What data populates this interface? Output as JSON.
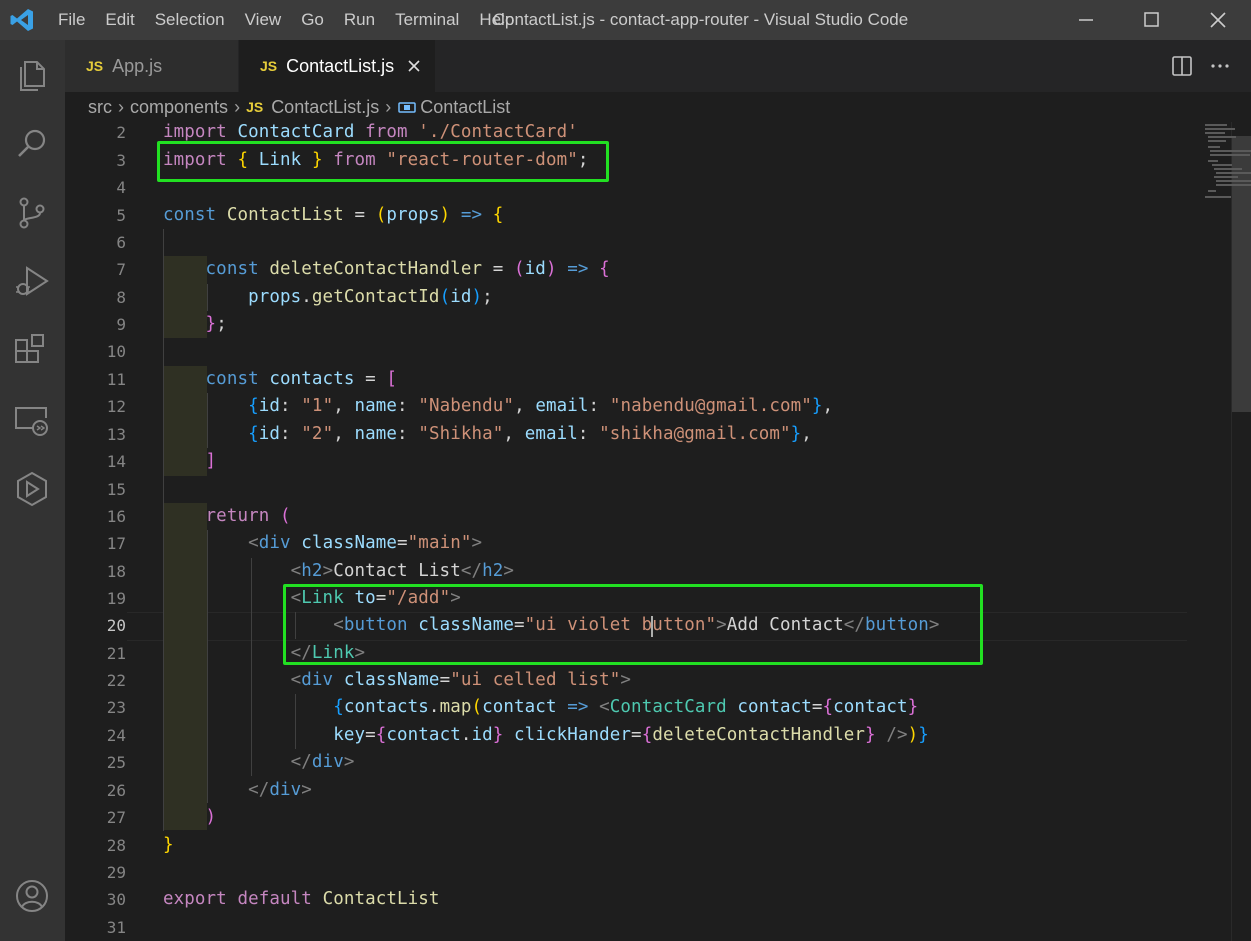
{
  "titlebar": {
    "menu": [
      "File",
      "Edit",
      "Selection",
      "View",
      "Go",
      "Run",
      "Terminal",
      "Help"
    ],
    "window_title": "ContactList.js - contact-app-router - Visual Studio Code"
  },
  "tabs": [
    {
      "badge": "JS",
      "label": "App.js",
      "active": false
    },
    {
      "badge": "JS",
      "label": "ContactList.js",
      "active": true
    }
  ],
  "breadcrumb": {
    "folder1": "src",
    "folder2": "components",
    "file_badge": "JS",
    "file": "ContactList.js",
    "symbol": "ContactList"
  },
  "editor": {
    "active_line": 20,
    "line_numbers": [
      "2",
      "3",
      "4",
      "5",
      "6",
      "7",
      "8",
      "9",
      "10",
      "11",
      "12",
      "13",
      "14",
      "15",
      "16",
      "17",
      "18",
      "19",
      "20",
      "21",
      "22",
      "23",
      "24",
      "25",
      "26",
      "27",
      "28",
      "29",
      "30",
      "31"
    ],
    "highlighted_blocks": [
      "import { Link } from \"react-router-dom\";",
      "<Link to=\"/add\"> ... </Link>"
    ]
  },
  "colors": {
    "highlight_box": "#22e022",
    "keyword": "#569cd6",
    "import_keyword": "#c586c0",
    "string": "#ce9178",
    "class": "#4ec9b0",
    "variable": "#9cdcfe",
    "function": "#dcdcaa"
  },
  "icons": {
    "activity_bar": [
      "explorer-icon",
      "search-icon",
      "source-control-icon",
      "run-debug-icon",
      "extensions-icon",
      "remote-explorer-icon",
      "live-share-icon",
      "accounts-icon"
    ]
  }
}
